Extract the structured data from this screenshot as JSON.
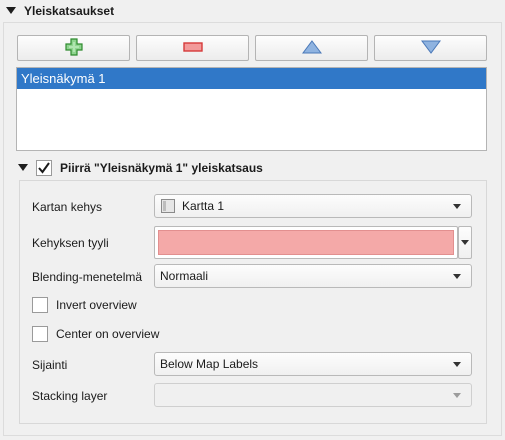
{
  "section": {
    "title": "Yleiskatsaukset"
  },
  "toolbar": {
    "add_icon": "plus-icon",
    "remove_icon": "minus-icon",
    "up_icon": "arrow-up-icon",
    "down_icon": "arrow-down-icon"
  },
  "overviews": {
    "items": [
      "Yleisnäkymä 1"
    ],
    "selected_index": 0
  },
  "group": {
    "title": "Piirrä \"Yleisnäkymä 1\" yleiskatsaus",
    "checked": true
  },
  "map_frame": {
    "label": "Kartan kehys",
    "value": "Kartta 1"
  },
  "frame_style": {
    "label": "Kehyksen tyyli",
    "color": "#f4a9a8"
  },
  "blending": {
    "label": "Blending-menetelmä",
    "value": "Normaali"
  },
  "invert": {
    "label": "Invert overview",
    "checked": false
  },
  "center": {
    "label": "Center on overview",
    "checked": false
  },
  "position": {
    "label": "Sijainti",
    "value": "Below Map Labels"
  },
  "stacking": {
    "label": "Stacking layer",
    "value": ""
  },
  "colors": {
    "selection": "#3078c8",
    "add": "#3a9a3a",
    "remove": "#d83a3a",
    "arrows": "#5b8cc8"
  }
}
